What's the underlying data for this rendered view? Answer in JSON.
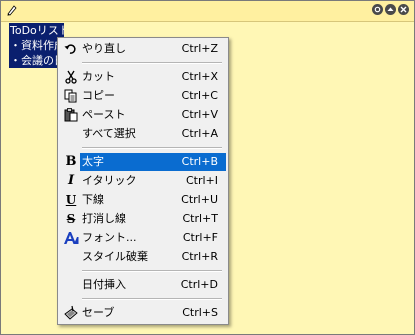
{
  "note": {
    "lines": [
      "ToDoリスト",
      "・資料作成",
      "・会議の日"
    ]
  },
  "menu": {
    "items": [
      {
        "label": "やり直し",
        "shortcut": "Ctrl+Z",
        "icon": "undo-icon"
      },
      {
        "label": "カット",
        "shortcut": "Ctrl+X",
        "icon": "scissors-icon"
      },
      {
        "label": "コピー",
        "shortcut": "Ctrl+C",
        "icon": "copy-icon"
      },
      {
        "label": "ペースト",
        "shortcut": "Ctrl+V",
        "icon": "paste-icon"
      },
      {
        "label": "すべて選択",
        "shortcut": "Ctrl+A",
        "icon": ""
      },
      {
        "label": "太字",
        "shortcut": "Ctrl+B",
        "icon": "bold-icon",
        "selected": true
      },
      {
        "label": "イタリック",
        "shortcut": "Ctrl+I",
        "icon": "italic-icon"
      },
      {
        "label": "下線",
        "shortcut": "Ctrl+U",
        "icon": "underline-icon"
      },
      {
        "label": "打消し線",
        "shortcut": "Ctrl+T",
        "icon": "strikethrough-icon"
      },
      {
        "label": "フォント...",
        "shortcut": "Ctrl+F",
        "icon": "font-icon"
      },
      {
        "label": "スタイル破棄",
        "shortcut": "Ctrl+R",
        "icon": ""
      },
      {
        "label": "日付挿入",
        "shortcut": "Ctrl+D",
        "icon": ""
      },
      {
        "label": "セーブ",
        "shortcut": "Ctrl+S",
        "icon": "save-icon"
      }
    ]
  },
  "colors": {
    "note_background": "#fff7b5",
    "selection": "#0a6cd0",
    "text_highlight": "#0a1f6e"
  }
}
